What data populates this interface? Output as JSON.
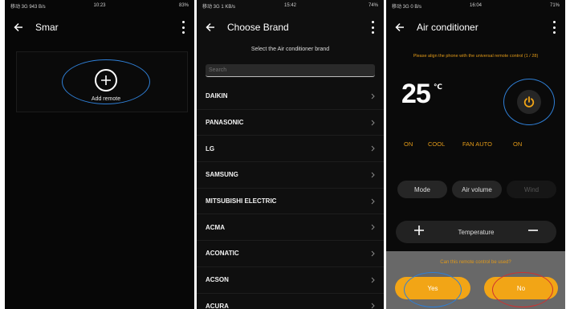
{
  "screens": {
    "home": {
      "status": {
        "left": "移动 3G 943 B/s",
        "time": "10:23",
        "right": "83%"
      },
      "title": "Smar",
      "add_label": "Add remote"
    },
    "brand": {
      "status": {
        "left": "移动 3G 1 KB/s",
        "time": "15:42",
        "right": "74%"
      },
      "title": "Choose Brand",
      "subtitle": "Select the Air conditioner brand",
      "search_placeholder": "Search",
      "brands": [
        "DAIKIN",
        "PANASONIC",
        "LG",
        "SAMSUNG",
        "MITSUBISHI ELECTRIC",
        "ACMA",
        "ACONATIC",
        "ACSON",
        "ACURA"
      ]
    },
    "remote": {
      "status": {
        "left": "移动 3G 0 B/s",
        "time": "16:04",
        "right": "71%"
      },
      "title": "Air conditioner",
      "align_message": "Please align the phone with the universal remote control (1 / 28)",
      "temperature": "25",
      "temperature_unit": "℃",
      "status_items": {
        "power": "ON",
        "mode": "COOL",
        "fan": "FAN AUTO",
        "swing": "ON"
      },
      "buttons": {
        "mode": "Mode",
        "air_volume": "Air volume",
        "wind": "Wind"
      },
      "temperature_label": "Temperature",
      "prompt": "Can this remote control be used?",
      "yes_label": "Yes",
      "no_label": "No"
    }
  },
  "colors": {
    "accent": "#e29a18",
    "button_orange": "#f2a516",
    "highlight_blue": "#2f7fd6",
    "highlight_red": "#d03030"
  }
}
